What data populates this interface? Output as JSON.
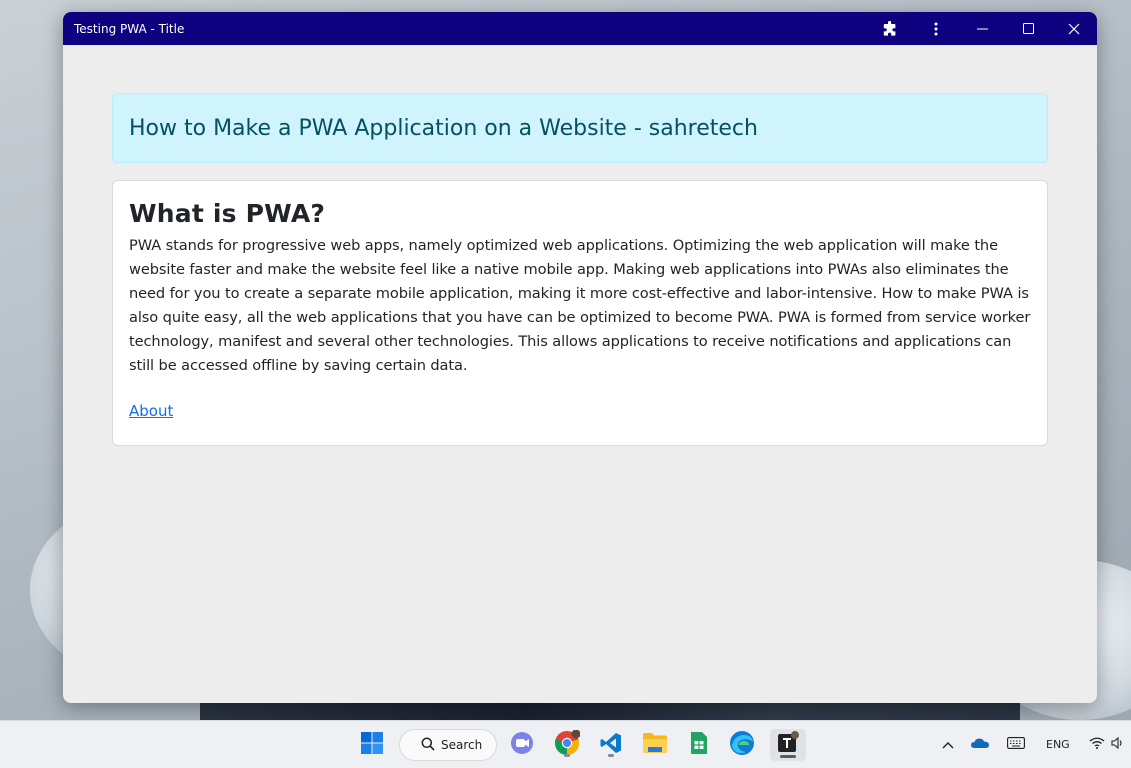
{
  "window": {
    "title": "Testing PWA - Title",
    "titlebar_color": "#0e0280",
    "controls": {
      "extensions_icon": "puzzle-icon",
      "menu_icon": "kebab-menu-icon",
      "minimize_icon": "minimize-icon",
      "maximize_icon": "maximize-icon",
      "close_icon": "close-icon"
    }
  },
  "page": {
    "alert_heading": "How to Make a PWA Application on a Website - sahretech",
    "card_title": "What is PWA?",
    "card_body": "PWA stands for progressive web apps, namely optimized web applications. Optimizing the web application will make the website faster and make the website feel like a native mobile app. Making web applications into PWAs also eliminates the need for you to create a separate mobile application, making it more cost-effective and labor-intensive. How to make PWA is also quite easy, all the web applications that you have can be optimized to become PWA. PWA is formed from service worker technology, manifest and several other technologies. This allows applications to receive notifications and applications can still be accessed offline by saving certain data.",
    "link_label": "About",
    "alert_bg": "#cff4fc",
    "alert_text_color": "#055160",
    "link_color": "#0d6efd"
  },
  "taskbar": {
    "search_label": "Search",
    "apps": [
      {
        "name": "start",
        "icon": "windows-logo-icon"
      },
      {
        "name": "teams",
        "icon": "teams-chat-icon"
      },
      {
        "name": "chrome",
        "icon": "chrome-icon"
      },
      {
        "name": "vscode",
        "icon": "vscode-icon"
      },
      {
        "name": "file-explorer",
        "icon": "folder-icon"
      },
      {
        "name": "sheets",
        "icon": "sheets-icon"
      },
      {
        "name": "edge",
        "icon": "edge-icon"
      },
      {
        "name": "pwa-app",
        "icon": "pwa-app-icon"
      }
    ],
    "tray": {
      "chevron_icon": "chevron-up-icon",
      "onedrive_icon": "cloud-icon",
      "keyboard_icon": "keyboard-icon",
      "language": "ENG",
      "wifi_icon": "wifi-icon",
      "volume_icon": "volume-icon"
    }
  }
}
